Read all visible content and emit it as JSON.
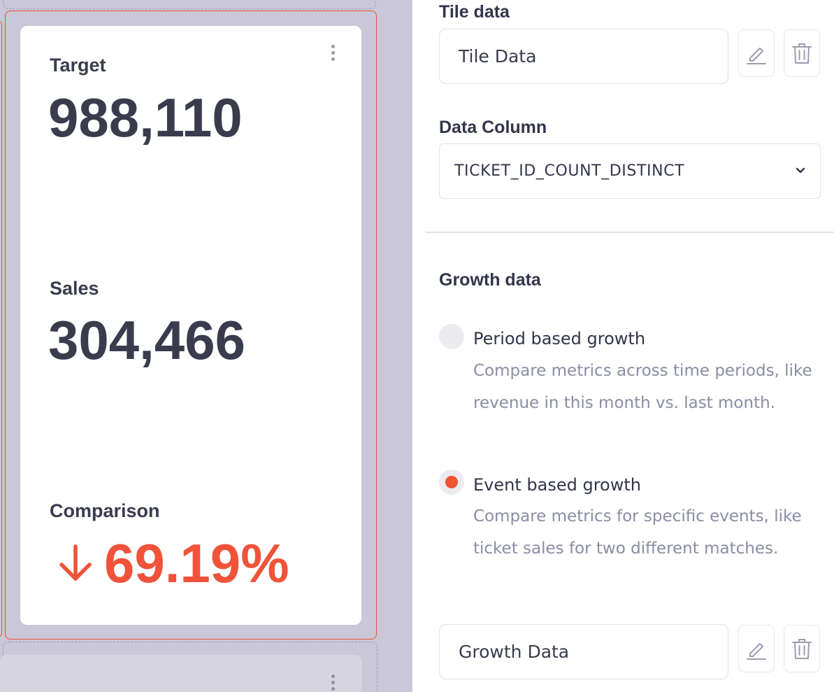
{
  "tile": {
    "metrics": [
      {
        "label": "Target",
        "value": "988,110"
      },
      {
        "label": "Sales",
        "value": "304,466"
      }
    ],
    "comparison": {
      "label": "Comparison",
      "value": "69.19%",
      "direction": "down",
      "color": "#f0533a"
    }
  },
  "panel": {
    "tile_data": {
      "label": "Tile data",
      "input_value": "Tile Data"
    },
    "data_column": {
      "label": "Data Column",
      "selected": "TICKET_ID_COUNT_DISTINCT"
    },
    "growth": {
      "label": "Growth data",
      "options": [
        {
          "title": "Period based growth",
          "description": "Compare metrics across time periods, like revenue in this month vs. last month.",
          "selected": false
        },
        {
          "title": "Event based growth",
          "description": "Compare metrics for specific events, like ticket sales for two different matches.",
          "selected": true
        }
      ],
      "input_value": "Growth Data"
    },
    "icons": {
      "edit": "pencil-icon",
      "delete": "trash-icon"
    },
    "accent_color": "#f0532f"
  }
}
